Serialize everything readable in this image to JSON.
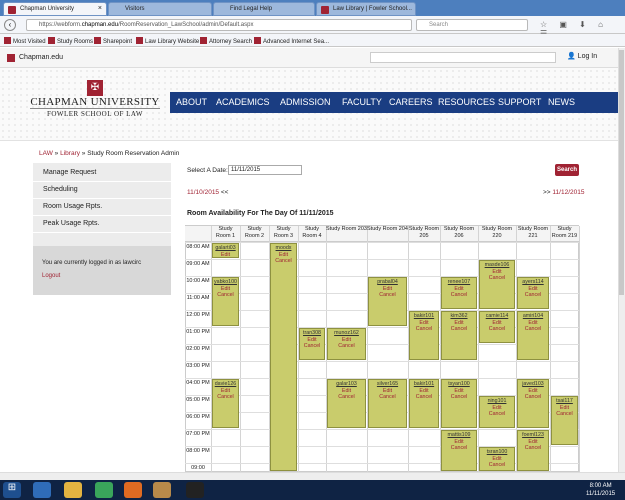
{
  "browser": {
    "tabs": [
      "Chapman University",
      "Visitors",
      "Find Legal Help",
      "Law Library | Fowler School..."
    ],
    "url_prefix": "https://webform.",
    "url_domain": "chapman.edu",
    "url_rest": "/RoomReservation_LawSchool/admin/Default.aspx",
    "search_placeholder": "Search",
    "bookmarks": [
      "Most Visited",
      "Study Rooms",
      "Sharepoint",
      "Law Library Website",
      "Attorney Search",
      "Advanced Internet Sea..."
    ]
  },
  "site": {
    "brand": "Chapman.edu",
    "login": "Log In",
    "university": "CHAPMAN UNIVERSITY",
    "school": "FOWLER SCHOOL OF LAW",
    "nav": [
      "ABOUT",
      "ACADEMICS",
      "ADMISSION",
      "FACULTY",
      "CAREERS",
      "RESOURCES",
      "SUPPORT",
      "NEWS"
    ]
  },
  "breadcrumb": {
    "law": "LAW",
    "sep": "»",
    "library": "Library",
    "page": "» Study Room Reservation Admin"
  },
  "sidebar": {
    "items": [
      "Manage Request",
      "Scheduling",
      "Room Usage Rpts.",
      "Peak Usage Rpts."
    ],
    "logged_in": "You are currently logged in as lawcirc",
    "logout": "Logout"
  },
  "form": {
    "label": "Select A Date:",
    "date": "11/11/2015",
    "search": "Search"
  },
  "pager": {
    "prev": "11/10/2015",
    "prev_arrow": "<<",
    "next_arrow": ">>",
    "next": "11/12/2015"
  },
  "availability_title": "Room Availability For The Day Of 11/11/2015",
  "schedule": {
    "rooms": [
      "Study Room 1",
      "Study Room 2",
      "Study Room 3",
      "Study Room 4",
      "Study Room 203",
      "Study Room 204",
      "Study Room 205",
      "Study Room 206",
      "Study Room 220",
      "Study Room 221",
      "Study Room 219"
    ],
    "times": [
      "08:00 AM",
      "09:00 AM",
      "10:00 AM",
      "11:00 AM",
      "12:00 PM",
      "01:00 PM",
      "02:00 PM",
      "03:00 PM",
      "04:00 PM",
      "05:00 PM",
      "06:00 PM",
      "07:00 PM",
      "08:00 PM",
      "09:00"
    ],
    "edit": "Edit",
    "cancel": "Cancel",
    "reservations": [
      {
        "room": 0,
        "start": 0,
        "end": 1,
        "user": "galarti03"
      },
      {
        "room": 0,
        "start": 2,
        "end": 5,
        "user": "yabko100"
      },
      {
        "room": 2,
        "start": 0,
        "end": 14,
        "user": "moodx"
      },
      {
        "room": 3,
        "start": 5,
        "end": 7,
        "user": "tran308"
      },
      {
        "room": 4,
        "start": 5,
        "end": 7,
        "user": "munoz162"
      },
      {
        "room": 5,
        "start": 2,
        "end": 5,
        "user": "prabal04"
      },
      {
        "room": 6,
        "start": 4,
        "end": 7,
        "user": "bakir101"
      },
      {
        "room": 7,
        "start": 2,
        "end": 4,
        "user": "renee107"
      },
      {
        "room": 7,
        "start": 4,
        "end": 7,
        "user": "kim362"
      },
      {
        "room": 8,
        "start": 1,
        "end": 4,
        "user": "masde106"
      },
      {
        "room": 8,
        "start": 4,
        "end": 6,
        "user": "camie114"
      },
      {
        "room": 9,
        "start": 2,
        "end": 4,
        "user": "ayers114"
      },
      {
        "room": 9,
        "start": 4,
        "end": 7,
        "user": "amiri104"
      },
      {
        "room": 0,
        "start": 8,
        "end": 11,
        "user": "davie126"
      },
      {
        "room": 4,
        "start": 8,
        "end": 11,
        "user": "galar103"
      },
      {
        "room": 5,
        "start": 8,
        "end": 11,
        "user": "silver165"
      },
      {
        "room": 6,
        "start": 8,
        "end": 11,
        "user": "bakir101"
      },
      {
        "room": 7,
        "start": 8,
        "end": 11,
        "user": "tsyan100"
      },
      {
        "room": 8,
        "start": 9,
        "end": 11,
        "user": "ning101"
      },
      {
        "room": 9,
        "start": 8,
        "end": 11,
        "user": "javed103"
      },
      {
        "room": 10,
        "start": 9,
        "end": 12,
        "user": "tsai117"
      },
      {
        "room": 7,
        "start": 11,
        "end": 14,
        "user": "mattis109"
      },
      {
        "room": 8,
        "start": 12,
        "end": 14,
        "user": "tsran100"
      },
      {
        "room": 9,
        "start": 11,
        "end": 14,
        "user": "foeml123"
      }
    ]
  },
  "taskbar": {
    "time": "8:00 AM",
    "date": "11/11/2015"
  }
}
